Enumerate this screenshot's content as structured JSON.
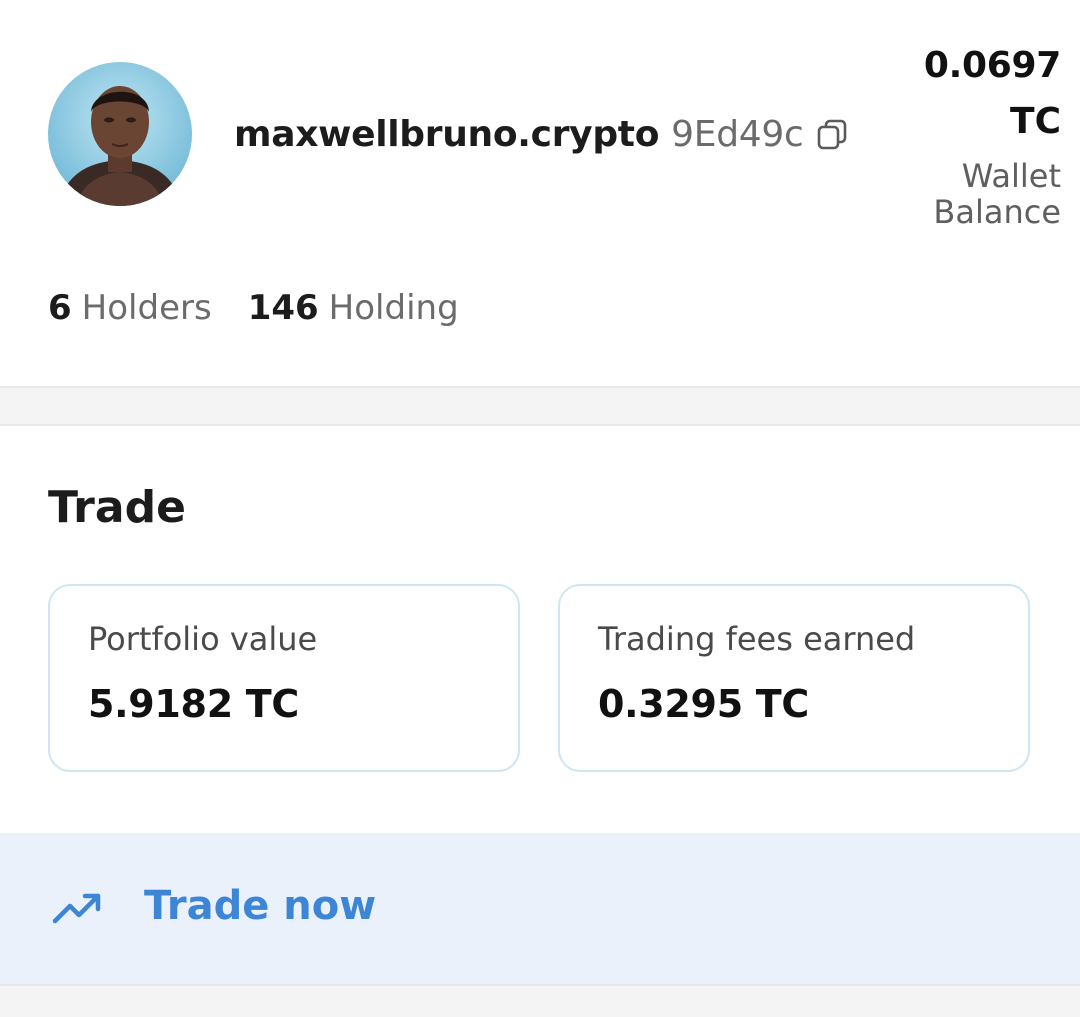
{
  "profile": {
    "username": "maxwellbruno.crypto",
    "address_short": "9Ed49c",
    "avatar_icon": "user-avatar",
    "copy_icon": "copy-icon"
  },
  "wallet": {
    "amount": "0.0697",
    "unit": "TC",
    "label_line1": "Wallet",
    "label_line2": "Balance"
  },
  "stats": {
    "holders_count": "6",
    "holders_label": "Holders",
    "holding_count": "146",
    "holding_label": "Holding"
  },
  "trade": {
    "title": "Trade",
    "portfolio_label": "Portfolio value",
    "portfolio_value": "5.9182 TC",
    "fees_label": "Trading fees earned",
    "fees_value": "0.3295 TC",
    "cta_label": "Trade now",
    "cta_icon": "trending-up-icon"
  },
  "colors": {
    "accent": "#3d86d6",
    "card_border": "#cfe6f2",
    "cta_background": "#ebf1fb",
    "muted_text": "#6b6b6b"
  }
}
